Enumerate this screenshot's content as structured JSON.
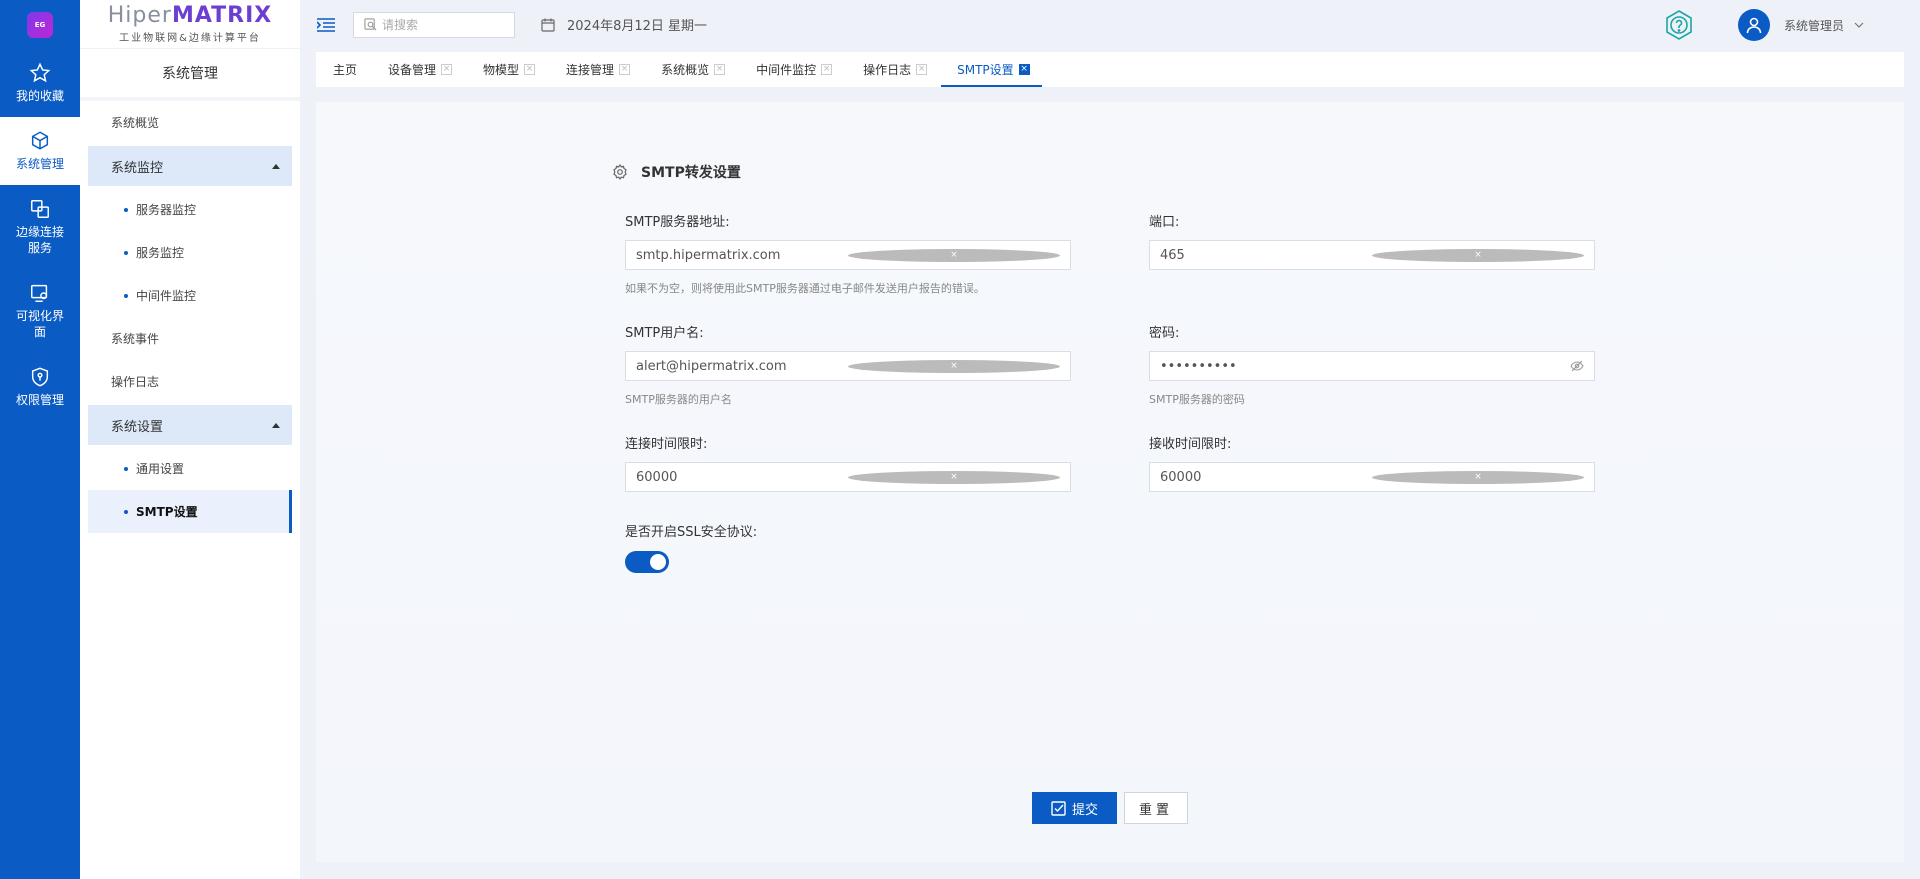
{
  "rail": {
    "logo_text": "EG",
    "items": [
      {
        "label": "我的收藏",
        "icon": "star-icon"
      },
      {
        "label": "系统管理",
        "icon": "cube-icon"
      },
      {
        "label": "边缘连接服务",
        "icon": "edge-connect-icon"
      },
      {
        "label": "可视化界面",
        "icon": "visual-screen-icon"
      },
      {
        "label": "权限管理",
        "icon": "shield-icon"
      }
    ]
  },
  "brand": {
    "name_prefix": "Hiper",
    "name_main": "MATRIX",
    "subtitle": "工业物联网&边缘计算平台"
  },
  "sidebar": {
    "title": "系统管理",
    "items": {
      "overview": "系统概览",
      "monitor_group": "系统监控",
      "server_monitor": "服务器监控",
      "service_monitor": "服务监控",
      "middleware_monitor": "中间件监控",
      "events": "系统事件",
      "oplog": "操作日志",
      "settings_group": "系统设置",
      "general_settings": "通用设置",
      "smtp_settings": "SMTP设置"
    }
  },
  "topbar": {
    "search_placeholder": "请搜索",
    "date": "2024年8月12日 星期一",
    "user_name": "系统管理员"
  },
  "tabs": [
    {
      "label": "主页",
      "closable": false
    },
    {
      "label": "设备管理",
      "closable": true
    },
    {
      "label": "物模型",
      "closable": true
    },
    {
      "label": "连接管理",
      "closable": true
    },
    {
      "label": "系统概览",
      "closable": true
    },
    {
      "label": "中间件监控",
      "closable": true
    },
    {
      "label": "操作日志",
      "closable": true
    },
    {
      "label": "SMTP设置",
      "closable": true,
      "active": true
    }
  ],
  "form": {
    "title": "SMTP转发设置",
    "server": {
      "label": "SMTP服务器地址:",
      "value": "smtp.hipermatrix.com",
      "hint": "如果不为空，则将使用此SMTP服务器通过电子邮件发送用户报告的错误。"
    },
    "port": {
      "label": "端口:",
      "value": "465"
    },
    "username": {
      "label": "SMTP用户名:",
      "value": "alert@hipermatrix.com",
      "hint": "SMTP服务器的用户名"
    },
    "password": {
      "label": "密码:",
      "value": "••••••••••",
      "hint": "SMTP服务器的密码"
    },
    "connect_timeout": {
      "label": "连接时间限时:",
      "value": "60000"
    },
    "receive_timeout": {
      "label": "接收时间限时:",
      "value": "60000"
    },
    "ssl": {
      "label": "是否开启SSL安全协议:",
      "enabled": true
    },
    "submit_label": "提交",
    "reset_label": "重置"
  },
  "colors": {
    "primary": "#0a5bc4",
    "sidebar_active_bg": "#dde8f8"
  }
}
